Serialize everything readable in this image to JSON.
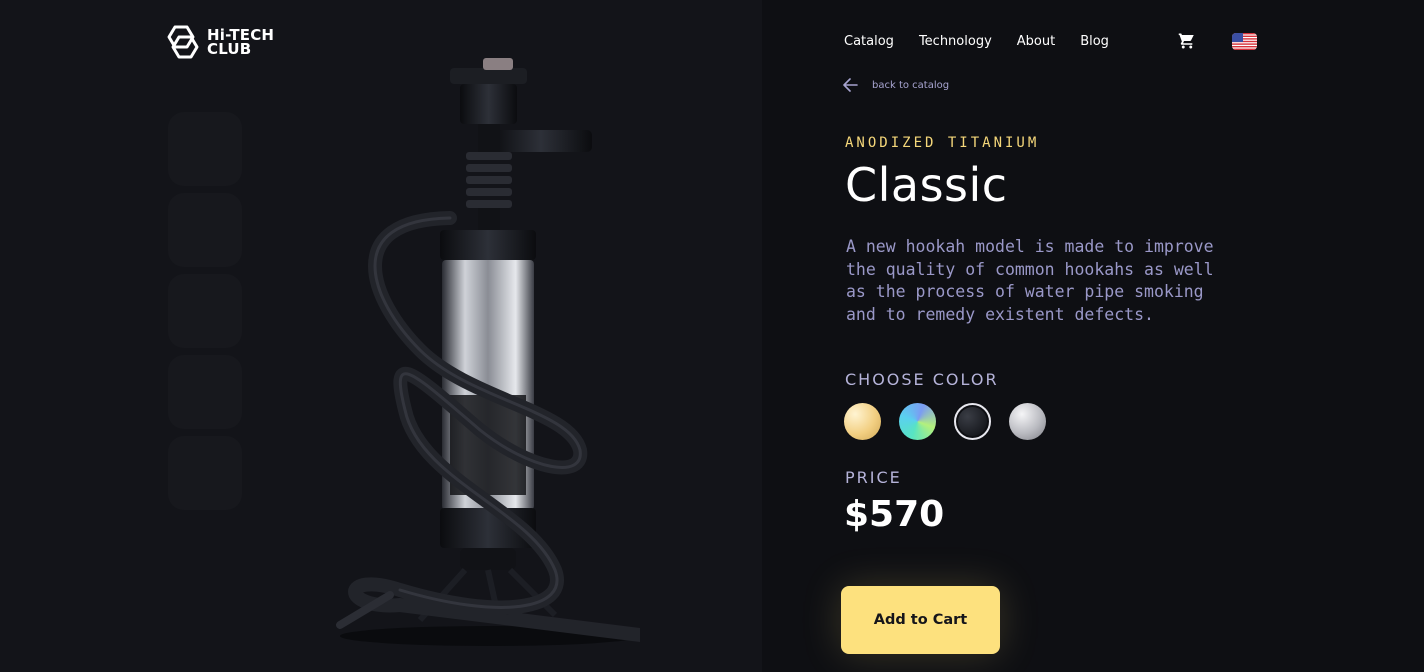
{
  "brand": {
    "line1": "Hi-TECH",
    "line2": "CLUB",
    "logo_icon": "hex-logo-icon"
  },
  "nav": {
    "items": [
      "Catalog",
      "Technology",
      "About",
      "Blog"
    ]
  },
  "header_icons": {
    "cart": "cart-icon",
    "language": "us-flag-icon"
  },
  "back_link": {
    "label": "back to catalog",
    "icon": "arrow-left-icon"
  },
  "product": {
    "subtitle": "ANODIZED TITANIUM",
    "title": "Classic",
    "description": "A new hookah model is made to improve the quality of common hookahs as well as the process of water pipe smoking and to remedy existent defects.",
    "color_label": "CHOOSE COLOR",
    "colors": [
      "gold",
      "aurora",
      "black",
      "silver"
    ],
    "selected_color": "black",
    "price_label": "PRICE",
    "price": "$570",
    "cta": "Add to Cart"
  },
  "thumbnails": 5,
  "colors": {
    "accent": "#fde17e",
    "subtitle": "#f5d77a",
    "muted": "#9a98c8",
    "background": "#0e0f13"
  }
}
